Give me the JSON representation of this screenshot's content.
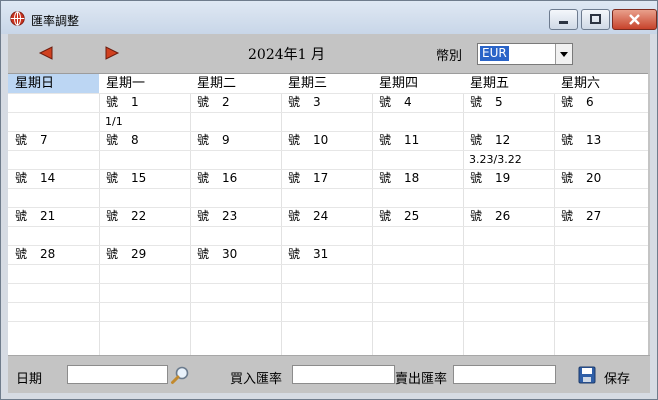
{
  "window": {
    "title": "匯率調整"
  },
  "header": {
    "month_title": "2024年1 月",
    "currency_label": "幣別",
    "currency_value": "EUR"
  },
  "weekdays": [
    "星期日",
    "星期一",
    "星期二",
    "星期三",
    "星期四",
    "星期五",
    "星期六"
  ],
  "day_prefix": "號",
  "weeks": [
    {
      "days": [
        "",
        "1",
        "2",
        "3",
        "4",
        "5",
        "6"
      ],
      "rates": [
        "",
        "1/1",
        "",
        "",
        "",
        "",
        ""
      ]
    },
    {
      "days": [
        "7",
        "8",
        "9",
        "10",
        "11",
        "12",
        "13"
      ],
      "rates": [
        "",
        "",
        "",
        "",
        "",
        "3.23/3.22",
        ""
      ]
    },
    {
      "days": [
        "14",
        "15",
        "16",
        "17",
        "18",
        "19",
        "20"
      ],
      "rates": [
        "",
        "",
        "",
        "",
        "",
        "",
        ""
      ]
    },
    {
      "days": [
        "21",
        "22",
        "23",
        "24",
        "25",
        "26",
        "27"
      ],
      "rates": [
        "",
        "",
        "",
        "",
        "",
        "",
        ""
      ]
    },
    {
      "days": [
        "28",
        "29",
        "30",
        "31",
        "",
        "",
        ""
      ],
      "rates": [
        "",
        "",
        "",
        "",
        "",
        "",
        ""
      ]
    }
  ],
  "footer": {
    "date_label": "日期",
    "date_value": "",
    "buy_rate_label": "買入匯率",
    "buy_rate_value": "",
    "sell_rate_label": "賣出匯率",
    "sell_rate_value": "",
    "save_label": "保存"
  },
  "colors": {
    "selected_weekday": "#bcd6f3",
    "currency_highlight": "#2a64c8",
    "nav_arrow": "#d0401f"
  },
  "icons": {
    "app": "globe-icon",
    "prev": "arrow-left-icon",
    "next": "arrow-right-icon",
    "search": "magnifier-icon",
    "save": "floppy-disk-icon"
  }
}
